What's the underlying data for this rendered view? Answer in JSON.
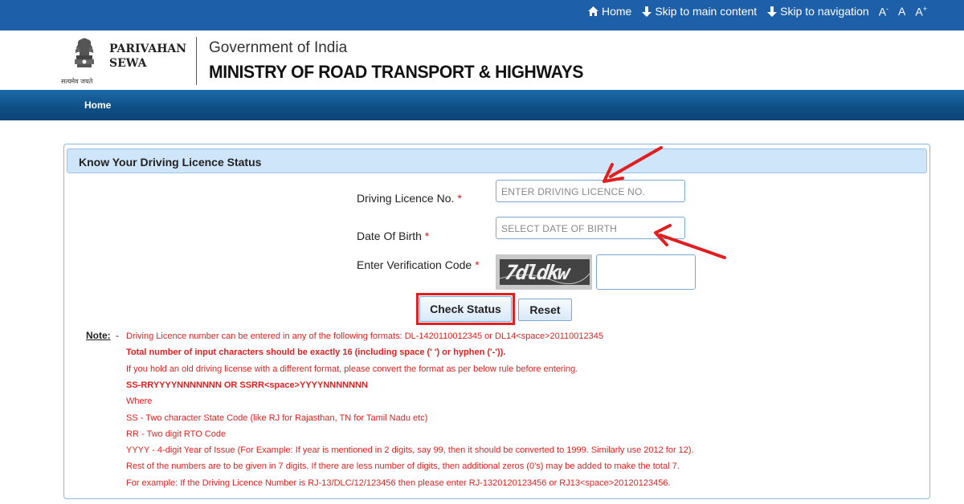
{
  "topbar": {
    "home": "Home",
    "skip_main": "Skip to main content",
    "skip_nav": "Skip to navigation",
    "font_decrease": "A",
    "font_normal": "A",
    "font_increase": "A",
    "minus": "-",
    "plus": "+"
  },
  "header": {
    "emblem_motto": "सत्यमेव जयते",
    "brand_line1": "PARIVAHAN",
    "brand_line2": "SEWA",
    "gov": "Government of India",
    "ministry": "MINISTRY OF ROAD TRANSPORT & HIGHWAYS"
  },
  "nav": {
    "home": "Home"
  },
  "panel": {
    "title": "Know Your Driving Licence Status",
    "dl_label": "Driving Licence No.",
    "dl_placeholder": "ENTER DRIVING LICENCE NO.",
    "dob_label": "Date Of Birth",
    "dob_placeholder": "SELECT DATE OF BIRTH",
    "captcha_label": "Enter Verification Code",
    "required_mark": "*",
    "captcha_text": "7dldkw",
    "check_button": "Check Status",
    "reset_button": "Reset"
  },
  "notes": {
    "heading": "Note:",
    "dash": "-",
    "lines": [
      "Driving Licence number can be entered in any of the following formats: DL-1420110012345 or DL14<space>20110012345",
      "Total number of input characters should be exactly 16 (including space (' ') or hyphen ('-')).",
      "If you hold an old driving license with a different format, please convert the format as per below rule before entering.",
      "SS-RRYYYYNNNNNNN OR SSRR<space>YYYYNNNNNNN",
      "Where",
      "SS - Two character State Code (like RJ for Rajasthan, TN for Tamil Nadu etc)",
      "RR - Two digit RTO Code",
      "YYYY - 4-digit Year of Issue (For Example: If year is mentioned in 2 digits, say 99, then it should be converted to 1999. Similarly use 2012 for 12).",
      "Rest of the numbers are to be given in 7 digits. If there are less number of digits, then additional zeros (0's) may be added to make the total 7.",
      "For example: If the Driving Licence Number is RJ-13/DLC/12/123456 then please enter RJ-1320120123456 or RJ13<space>20120123456."
    ]
  },
  "colors": {
    "topbar": "#1d5fa8",
    "navbar": "#0f4e86",
    "panel_head": "#cfe5f9",
    "note_red": "#e02020",
    "annotation_red": "#e02020"
  }
}
